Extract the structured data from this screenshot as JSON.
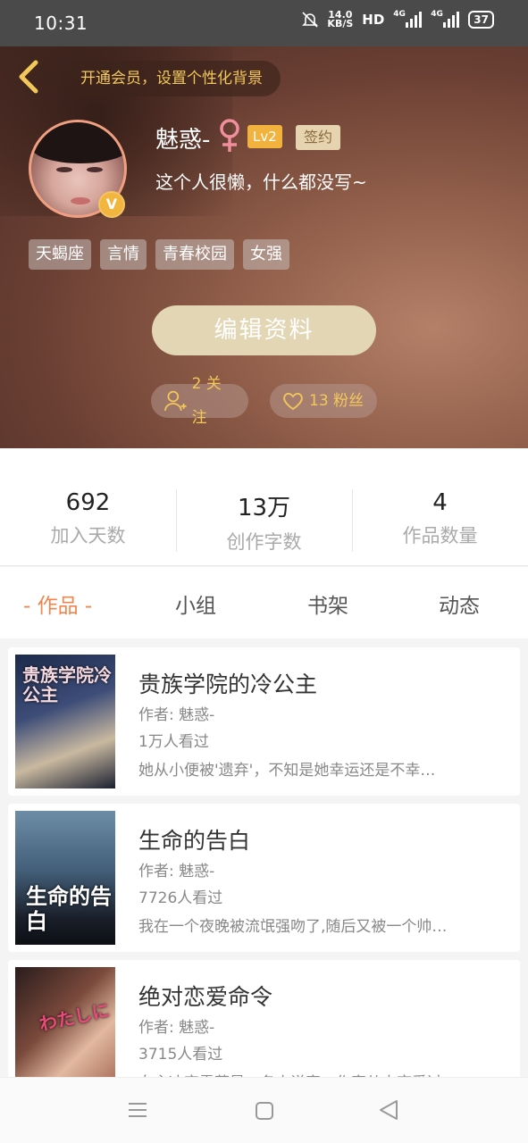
{
  "status_bar": {
    "time": "10:31",
    "speed_value": "14.0",
    "speed_unit": "KB/S",
    "hd": "HD",
    "sig1": "4G",
    "sig2": "4G",
    "battery": "37"
  },
  "header": {
    "vip_banner": "开通会员，设置个性化背景",
    "name": "魅惑-",
    "level": "Lv2",
    "signed_badge": "签约",
    "avatar_badge": "V",
    "bio": "这个人很懒，什么都没写~",
    "tags": [
      "天蝎座",
      "言情",
      "青春校园",
      "女强"
    ],
    "edit_button": "编辑资料",
    "following": "2 关注",
    "fans": "13 粉丝"
  },
  "stats": [
    {
      "value": "692",
      "label": "加入天数"
    },
    {
      "value": "13万",
      "label": "创作字数"
    },
    {
      "value": "4",
      "label": "作品数量"
    }
  ],
  "tabs": [
    "- 作品 -",
    "小组",
    "书架",
    "动态"
  ],
  "works": [
    {
      "title": "贵族学院的冷公主",
      "author": "作者: 魅惑-",
      "views": "1万人看过",
      "desc": "她从小便被'遗弃'，不知是她幸运还是不幸…",
      "cover_text": "贵族学院冷公主"
    },
    {
      "title": "生命的告白",
      "author": "作者: 魅惑-",
      "views": "7726人看过",
      "desc": "我在一个夜晚被流氓强吻了,随后又被一个帅…",
      "cover_text": "生命的告白"
    },
    {
      "title": "绝对恋爱命令",
      "author": "作者: 魅惑-",
      "views": "3715人看过",
      "desc": "女主冰突霏菲是一名小说家，作家从未恋爱过…",
      "cover_text": "わたしに"
    }
  ],
  "colors": {
    "accent": "#f0864e",
    "gold": "#f2c85a",
    "edit_bg": "#e3d6b4"
  }
}
